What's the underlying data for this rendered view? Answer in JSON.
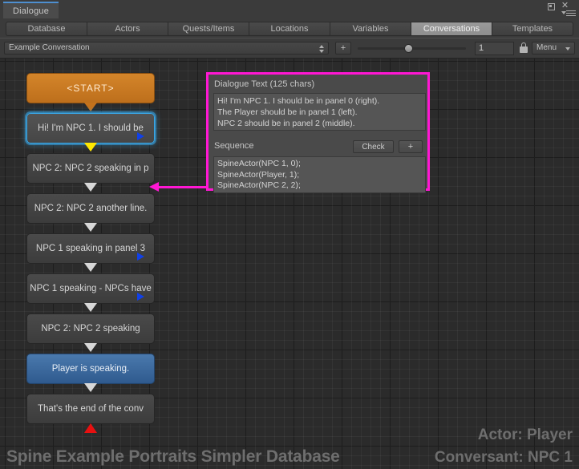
{
  "window": {
    "tab_label": "Dialogue",
    "maximize_icon": "maximize-icon",
    "close_icon": "close-icon",
    "menu_icon": "hamburger-menu-icon"
  },
  "tabs": [
    {
      "label": "Database",
      "selected": false
    },
    {
      "label": "Actors",
      "selected": false
    },
    {
      "label": "Quests/Items",
      "selected": false
    },
    {
      "label": "Locations",
      "selected": false
    },
    {
      "label": "Variables",
      "selected": false
    },
    {
      "label": "Conversations",
      "selected": true
    },
    {
      "label": "Templates",
      "selected": false
    }
  ],
  "toolbar": {
    "conversation_value": "Example Conversation",
    "add_label": "+",
    "zoom_value": "1",
    "menu_label": "Menu",
    "lock_icon": "lock-icon",
    "slider_icon": "zoom-slider"
  },
  "nodes": [
    {
      "id": "start",
      "label": "<START>",
      "type": "start",
      "selected": false,
      "has_blue_marker": false
    },
    {
      "id": "n1",
      "label": "Hi! I'm NPC 1. I should be",
      "type": "npc",
      "selected": true,
      "has_blue_marker": true
    },
    {
      "id": "n2",
      "label": "NPC 2: NPC 2 speaking in p",
      "type": "npc",
      "selected": false,
      "has_blue_marker": false
    },
    {
      "id": "n3",
      "label": "NPC 2: NPC 2 another line.",
      "type": "npc",
      "selected": false,
      "has_blue_marker": false
    },
    {
      "id": "n4",
      "label": "NPC 1 speaking in panel 3",
      "type": "npc",
      "selected": false,
      "has_blue_marker": true
    },
    {
      "id": "n5",
      "label": "NPC 1 speaking - NPCs have",
      "type": "npc",
      "selected": false,
      "has_blue_marker": true
    },
    {
      "id": "n6",
      "label": "NPC 2: NPC 2 speaking",
      "type": "npc",
      "selected": false,
      "has_blue_marker": false
    },
    {
      "id": "n7",
      "label": "Player is speaking.",
      "type": "player",
      "selected": false,
      "has_blue_marker": false
    },
    {
      "id": "n8",
      "label": "That's the end of the conv",
      "type": "npc",
      "selected": false,
      "has_blue_marker": false
    }
  ],
  "inspector": {
    "dialogue_text_label": "Dialogue Text (125 chars)",
    "dialogue_text_value": "Hi! I'm NPC 1. I should be in panel 0 (right).\nThe Player should be in panel 1 (left).\nNPC 2 should be in panel 2 (middle).",
    "sequence_label": "Sequence",
    "check_label": "Check",
    "add_label": "+",
    "sequence_value": "SpineActor(NPC 1, 0);\nSpineActor(Player, 1);\nSpineActor(NPC 2, 2);",
    "border_color": "#ff17d4"
  },
  "overlay": {
    "database_name": "Spine Example Portraits Simpler Database",
    "actor_line": "Actor: Player",
    "conversant_line": "Conversant: NPC 1"
  },
  "colors": {
    "accent_selection": "#3aa8e8",
    "start_node": "#c4721c",
    "player_node": "#2f5a8e",
    "selection_arrow": "#ff17d4",
    "connector_default": "#d8d8d8",
    "connector_yellow": "#ffe800",
    "connector_red": "#e81010"
  }
}
